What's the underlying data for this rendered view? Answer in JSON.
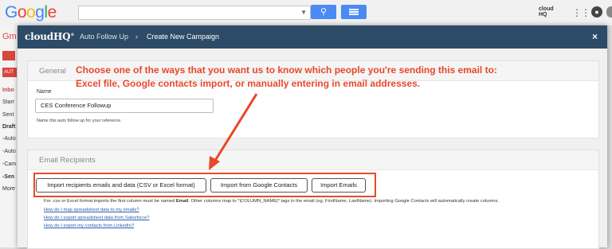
{
  "gmail": {
    "logo": "Google",
    "mail_label": "Gm",
    "auto_row": "AUT",
    "sidebar_items": [
      "Inbo",
      "Starr",
      "Sent",
      "Draft",
      "-Auto",
      "-Auto",
      "-Cam",
      "-Sen",
      "More"
    ],
    "cloudhq_badge": "cloud HQ"
  },
  "modal": {
    "brand": "cloudHQ",
    "breadcrumb_parent": "Auto Follow Up",
    "breadcrumb_sep": "›",
    "breadcrumb_current": "Create New Campaign",
    "close": "×"
  },
  "general": {
    "title": "General",
    "name_label": "Name",
    "name_value": "CES Conference Followup",
    "name_help": "Name this auto follow up for your reference."
  },
  "recipients": {
    "title": "Email Recipients",
    "btn_import_csv": "Import recipients emails and data (CSV or Excel format)",
    "btn_import_google": "Import from Google Contacts",
    "btn_import_emails": "Import Emails",
    "note": "For .csv or Excel format imports the first column must be named Email. Other columns map to *|COLUMN_NAME|* tags in the email (eg. FirstName, LastName). Importing Google Contacts will automatically create columns.",
    "links": [
      "How do I map spreadsheet data to my emails?",
      "How do I export spreadsheet data from Salesforce?",
      "How do I export my contacts from LinkedIn?"
    ]
  },
  "annotation": {
    "line1": "Choose one of the ways that you want us to know which people you're sending this email to:",
    "line2": "Excel file, Google contacts import, or manually entering in email addresses.",
    "color": "#e8472a"
  }
}
